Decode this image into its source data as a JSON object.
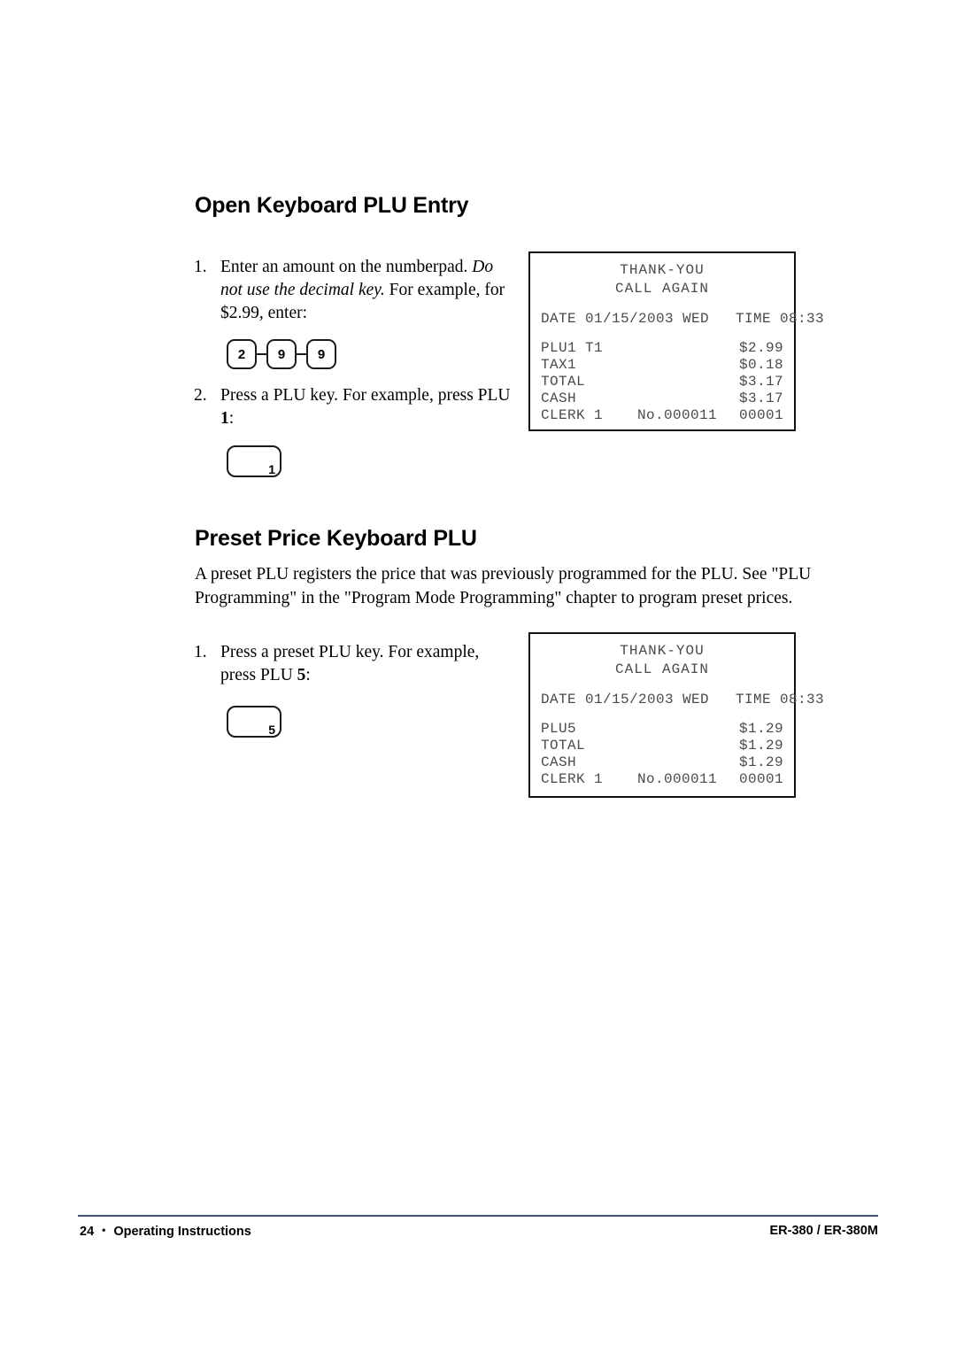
{
  "document": {
    "page_number": "24",
    "footer_left_label": "Operating Instructions",
    "footer_bullet": "•",
    "footer_right": "ER-380 / ER-380M"
  },
  "sections": [
    {
      "heading": "Open Keyboard PLU Entry",
      "steps": [
        {
          "number": "1.",
          "text_part1": "Enter an amount on the numberpad.",
          "text_italic": "Do not use the decimal key.",
          "text_part2": "For example, for $2.99, enter:"
        },
        {
          "number": "2.",
          "text_part1": "Press a PLU key.",
          "text_part2": "For example, press PLU",
          "bold_token": "1",
          "text_part3": ":"
        }
      ],
      "keys": [
        "2",
        "9",
        "9"
      ],
      "plu_key_label": "1"
    },
    {
      "heading": "Preset Price Keyboard PLU",
      "paragraph": "A preset PLU registers the price that was previously programmed for the PLU.   See \"PLU Programming\" in the \"Program Mode Programming\" chapter to program preset prices.",
      "steps": [
        {
          "number": "1.",
          "text_part1": "Press a preset PLU key.",
          "text_part2": "For example, press PLU",
          "bold_token": "5",
          "text_part3": ":"
        }
      ],
      "plu_key_label": "5"
    }
  ],
  "receipts": [
    {
      "header_line1": "THANK-YOU",
      "header_line2": "CALL AGAIN",
      "datetime": "DATE 01/15/2003 WED   TIME 08:33",
      "lines": [
        {
          "label": "PLU1 T1",
          "value": "$2.99"
        },
        {
          "label": "TAX1",
          "value": "$0.18"
        },
        {
          "label": "TOTAL",
          "value": "$3.17"
        },
        {
          "label": "CASH",
          "value": "$3.17"
        }
      ],
      "clerk_label": "CLERK 1",
      "clerk_number": "No.000011",
      "clerk_counter": "00001"
    },
    {
      "header_line1": "THANK-YOU",
      "header_line2": "CALL AGAIN",
      "datetime": "DATE 01/15/2003 WED   TIME 08:33",
      "lines": [
        {
          "label": "PLU5",
          "value": "$1.29"
        },
        {
          "label": "TOTAL",
          "value": "$1.29"
        },
        {
          "label": "CASH",
          "value": "$1.29"
        }
      ],
      "clerk_label": "CLERK 1",
      "clerk_number": "No.000011",
      "clerk_counter": "00001"
    }
  ]
}
